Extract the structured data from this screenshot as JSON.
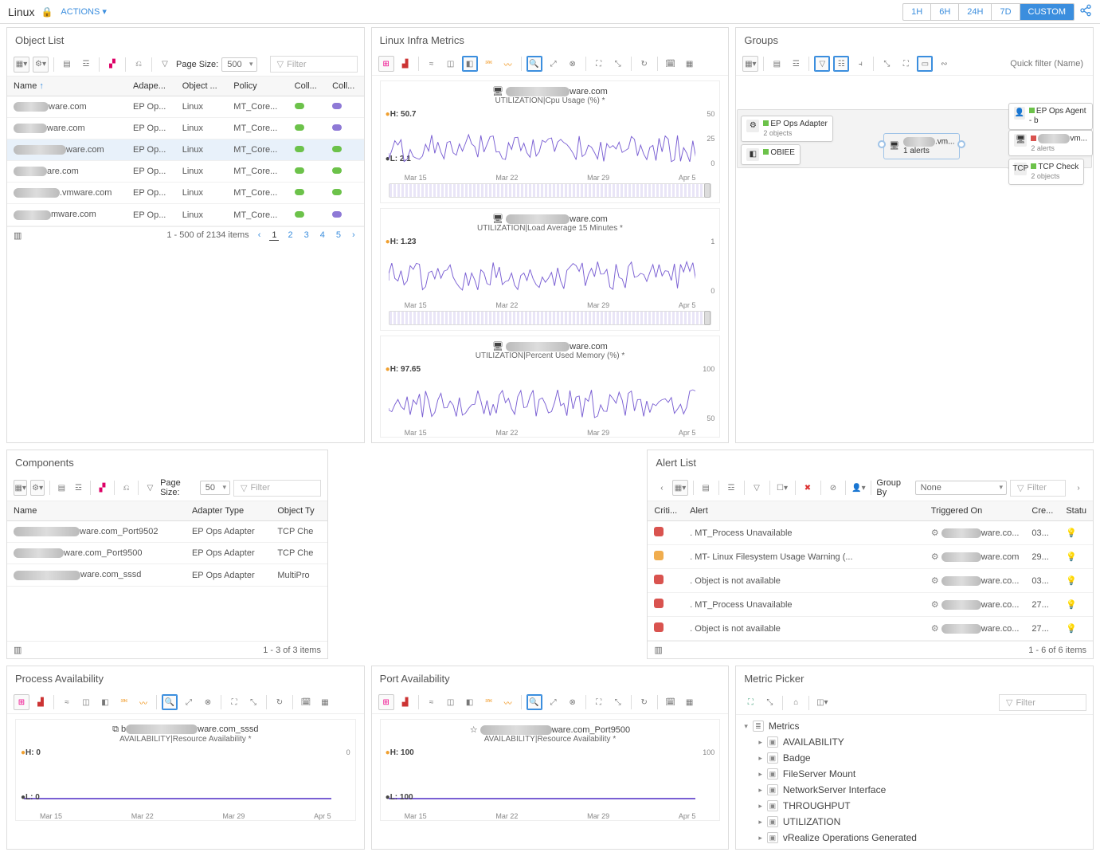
{
  "header": {
    "title": "Linux",
    "actions_label": "ACTIONS",
    "time_ranges": [
      "1H",
      "6H",
      "24H",
      "7D",
      "CUSTOM"
    ],
    "active_range": "CUSTOM"
  },
  "object_list": {
    "title": "Object List",
    "page_size_label": "Page Size:",
    "page_size_value": "500",
    "filter_placeholder": "Filter",
    "columns": [
      "Name",
      "Adape...",
      "Object ...",
      "Policy",
      "Coll...",
      "Coll..."
    ],
    "rows": [
      {
        "name_suffix": "ware.com",
        "adapter": "EP Op...",
        "obj": "Linux",
        "policy": "MT_Core...",
        "c1": "green",
        "c2": "purple"
      },
      {
        "name_suffix": "ware.com",
        "adapter": "EP Op...",
        "obj": "Linux",
        "policy": "MT_Core...",
        "c1": "green",
        "c2": "purple"
      },
      {
        "name_suffix": "ware.com",
        "adapter": "EP Op...",
        "obj": "Linux",
        "policy": "MT_Core...",
        "c1": "green",
        "c2": "green",
        "sel": true
      },
      {
        "name_suffix": "are.com",
        "adapter": "EP Op...",
        "obj": "Linux",
        "policy": "MT_Core...",
        "c1": "green",
        "c2": "green"
      },
      {
        "name_suffix": ".vmware.com",
        "adapter": "EP Op...",
        "obj": "Linux",
        "policy": "MT_Core...",
        "c1": "green",
        "c2": "green"
      },
      {
        "name_suffix": "mware.com",
        "adapter": "EP Op...",
        "obj": "Linux",
        "policy": "MT_Core...",
        "c1": "green",
        "c2": "purple"
      }
    ],
    "footer_count": "1 - 500 of 2134 items",
    "pages": [
      "1",
      "2",
      "3",
      "4",
      "5"
    ]
  },
  "components": {
    "title": "Components",
    "page_size_label": "Page Size:",
    "page_size_value": "50",
    "filter_placeholder": "Filter",
    "columns": [
      "Name",
      "Adapter Type",
      "Object Ty"
    ],
    "rows": [
      {
        "name_suffix": "ware.com_Port9502",
        "adapter": "EP Ops Adapter",
        "obj": "TCP Che"
      },
      {
        "name_suffix": "ware.com_Port9500",
        "adapter": "EP Ops Adapter",
        "obj": "TCP Che"
      },
      {
        "name_suffix": "ware.com_sssd",
        "adapter": "EP Ops Adapter",
        "obj": "MultiPro"
      }
    ],
    "footer_count": "1 - 3 of 3 items"
  },
  "infra": {
    "title": "Linux Infra Metrics",
    "dates": [
      "Mar 15",
      "Mar 22",
      "Mar 29",
      "Apr 5"
    ],
    "charts": [
      {
        "host": "ware.com",
        "metric": "UTILIZATION|Cpu Usage (%) *",
        "h": "H: 50.7",
        "l": "L: 2.1",
        "ymax": "50",
        "ymid": "25",
        "ymin": "0"
      },
      {
        "host": "ware.com",
        "metric": "UTILIZATION|Load Average 15 Minutes *",
        "h": "H: 1.23",
        "ymax": "1",
        "ymin": "0"
      },
      {
        "host": "ware.com",
        "metric": "UTILIZATION|Percent Used Memory (%) *",
        "h": "H: 97.65",
        "ymax": "100",
        "ymin": "50"
      }
    ]
  },
  "groups": {
    "title": "Groups",
    "quick_filter_placeholder": "Quick filter (Name)",
    "left_nodes": [
      {
        "label": "EP Ops Adapter",
        "sub": "2 objects",
        "status": "g"
      },
      {
        "label": "OBIEE",
        "sub": "",
        "status": "g"
      }
    ],
    "center": {
      "host_suffix": ".vm...",
      "sub": "1 alerts"
    },
    "right_nodes": [
      {
        "label": "EP Ops Agent - b",
        "sub": ""
      },
      {
        "label": "vm...",
        "sub": "2 alerts",
        "status": "r"
      },
      {
        "label": "TCP Check",
        "sub": "2 objects",
        "status": "g"
      }
    ]
  },
  "alerts": {
    "title": "Alert List",
    "group_by_label": "Group By",
    "group_by_value": "None",
    "filter_placeholder": "Filter",
    "columns": [
      "Criti...",
      "Alert",
      "Triggered On",
      "Cre...",
      "Statu"
    ],
    "rows": [
      {
        "sev": "red",
        "alert": ". MT_Process Unavailable",
        "trig_suffix": "ware.co...",
        "cre": "03...",
        "bulb": "y"
      },
      {
        "sev": "yellow",
        "alert": ". MT- Linux Filesystem Usage Warning (...",
        "trig_suffix": "ware.com",
        "cre": "29...",
        "bulb": "y"
      },
      {
        "sev": "red",
        "alert": ". Object is not available",
        "trig_suffix": "ware.co...",
        "cre": "03...",
        "bulb": "y"
      },
      {
        "sev": "red",
        "alert": ". MT_Process Unavailable",
        "trig_suffix": "ware.co...",
        "cre": "27...",
        "bulb": "g"
      },
      {
        "sev": "red",
        "alert": ". Object is not available",
        "trig_suffix": "ware.co...",
        "cre": "27...",
        "bulb": "g"
      }
    ],
    "footer_count": "1 - 6 of 6 items"
  },
  "process_avail": {
    "title": "Process Availability",
    "host_suffix": "ware.com_sssd",
    "metric": "AVAILABILITY|Resource Availability *",
    "h": "H: 0",
    "l": "L: 0",
    "y": "0",
    "dates": [
      "Mar 15",
      "Mar 22",
      "Mar 29",
      "Apr 5"
    ]
  },
  "port_avail": {
    "title": "Port Availability",
    "host_suffix": "ware.com_Port9500",
    "metric": "AVAILABILITY|Resource Availability *",
    "h": "H: 100",
    "l": "L: 100",
    "y": "100",
    "dates": [
      "Mar 15",
      "Mar 22",
      "Mar 29",
      "Apr 5"
    ]
  },
  "metric_picker": {
    "title": "Metric Picker",
    "filter_placeholder": "Filter",
    "root": "Metrics",
    "items": [
      "AVAILABILITY",
      "Badge",
      "FileServer Mount",
      "NetworkServer Interface",
      "THROUGHPUT",
      "UTILIZATION",
      "vRealize Operations Generated"
    ]
  },
  "chart_data": [
    {
      "type": "line",
      "title": "UTILIZATION|Cpu Usage (%)",
      "ylim": [
        0,
        50
      ],
      "x_categories": [
        "Mar 15",
        "Mar 22",
        "Mar 29",
        "Apr 5"
      ],
      "stats": {
        "high": 50.7,
        "low": 2.1
      },
      "note": "dense noisy series ~5-45 range"
    },
    {
      "type": "line",
      "title": "UTILIZATION|Load Average 15 Minutes",
      "ylim": [
        0,
        1
      ],
      "x_categories": [
        "Mar 15",
        "Mar 22",
        "Mar 29",
        "Apr 5"
      ],
      "stats": {
        "high": 1.23
      },
      "note": "oscillating ~0.2-1.1"
    },
    {
      "type": "line",
      "title": "UTILIZATION|Percent Used Memory (%)",
      "ylim": [
        50,
        100
      ],
      "x_categories": [
        "Mar 15",
        "Mar 22",
        "Mar 29",
        "Apr 5"
      ],
      "stats": {
        "high": 97.65
      },
      "note": "~60-98 range"
    },
    {
      "type": "line",
      "title": "AVAILABILITY|Resource Availability (Process)",
      "ylim": [
        0,
        0
      ],
      "x_categories": [
        "Mar 15",
        "Mar 22",
        "Mar 29",
        "Apr 5"
      ],
      "values": [
        0,
        0,
        0,
        0
      ]
    },
    {
      "type": "line",
      "title": "AVAILABILITY|Resource Availability (Port)",
      "ylim": [
        100,
        100
      ],
      "x_categories": [
        "Mar 15",
        "Mar 22",
        "Mar 29",
        "Apr 5"
      ],
      "values": [
        100,
        100,
        100,
        100
      ]
    }
  ]
}
